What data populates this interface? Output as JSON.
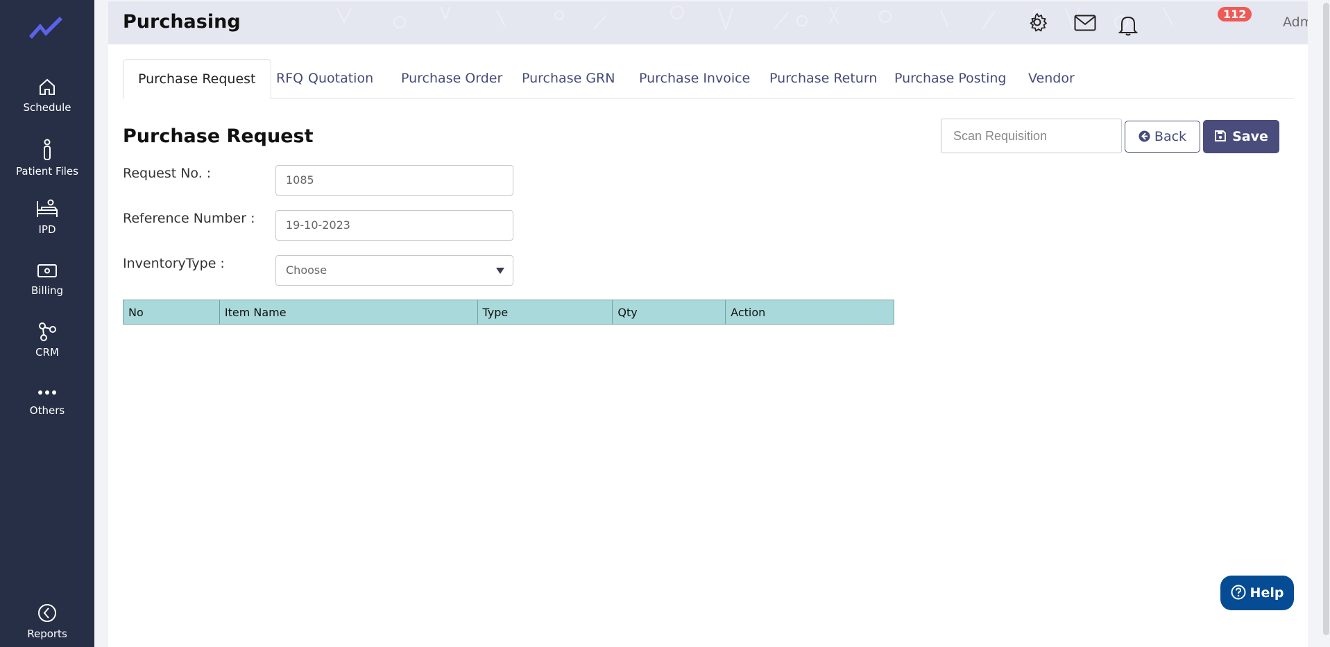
{
  "sidebar": {
    "items": [
      {
        "label": "Schedule",
        "icon": "home-icon"
      },
      {
        "label": "Patient Files",
        "icon": "person-icon"
      },
      {
        "label": "IPD",
        "icon": "bed-icon"
      },
      {
        "label": "Billing",
        "icon": "cash-icon"
      },
      {
        "label": "CRM",
        "icon": "network-icon"
      },
      {
        "label": "Others",
        "icon": "ellipsis-icon"
      },
      {
        "label": "Reports",
        "icon": "chart-pie-icon"
      }
    ]
  },
  "header": {
    "title": "Purchasing",
    "notification_count": "112",
    "user_name": "Administrator"
  },
  "tabs": [
    {
      "label": "Purchase Request",
      "active": true
    },
    {
      "label": "RFQ"
    },
    {
      "label": "Quotation"
    },
    {
      "label": "Purchase Order"
    },
    {
      "label": "Purchase GRN"
    },
    {
      "label": "Purchase Invoice"
    },
    {
      "label": "Purchase Return"
    },
    {
      "label": "Purchase Posting"
    },
    {
      "label": "Vendor"
    }
  ],
  "form": {
    "title": "Purchase Request",
    "request_no_label": "Request No. :",
    "request_no_value": "1085",
    "reference_label": "Reference Number :",
    "reference_value": "19-10-2023",
    "inventory_label": "InventoryType :",
    "inventory_value": "Choose"
  },
  "actions": {
    "scan_placeholder": "Scan Requisition",
    "back_label": "Back",
    "save_label": "Save"
  },
  "table": {
    "columns": [
      "No",
      "Item Name",
      "Type",
      "Qty",
      "Action"
    ],
    "rows": []
  },
  "help": {
    "label": "Help"
  },
  "colors": {
    "sidebar": "#262f45",
    "accent": "#4a4c7c",
    "table_header": "#a9d9da",
    "badge": "#ee5b57",
    "help": "#054c94"
  }
}
